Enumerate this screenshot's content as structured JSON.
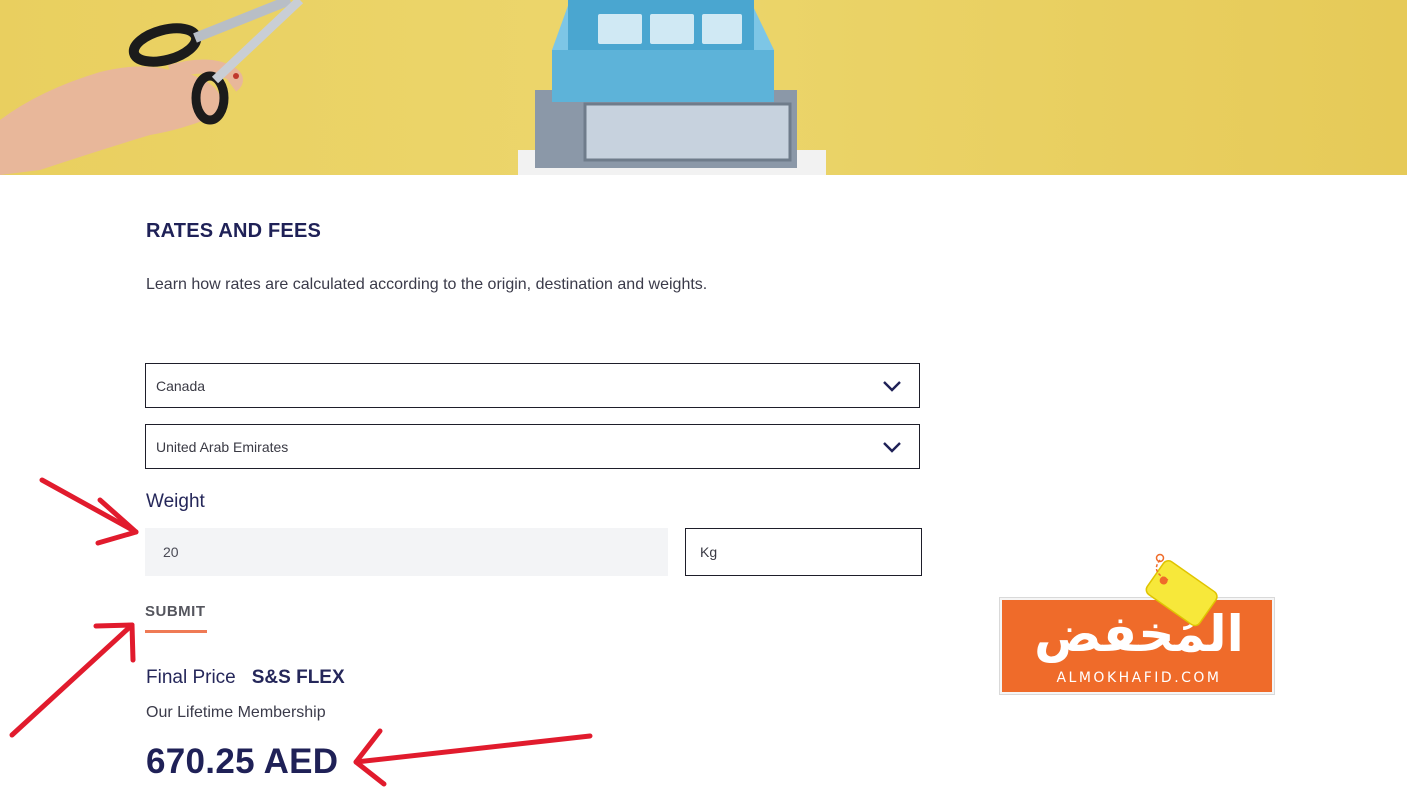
{
  "section": {
    "title": "RATES AND FEES",
    "description": "Learn how rates are calculated according to the origin, destination and weights."
  },
  "form": {
    "origin": "Canada",
    "destination": "United Arab Emirates",
    "weight_label": "Weight",
    "weight_value": "20",
    "unit": "Kg",
    "submit_label": "SUBMIT"
  },
  "result": {
    "final_label": "Final Price",
    "plan_name": "S&S FLEX",
    "plan_subtitle": "Our Lifetime Membership",
    "price": "670.25 AED"
  },
  "watermark": {
    "arabic": "المُخفض",
    "domain": "ALMOKHAFID.COM"
  },
  "colors": {
    "accent": "#ef7a55",
    "heading": "#1f2157",
    "banner": "#e9cf5f",
    "arrow": "#e11b2d",
    "logo": "#ef6b2a"
  },
  "icons": [
    "chevron-down-icon",
    "arrow-annotation"
  ]
}
